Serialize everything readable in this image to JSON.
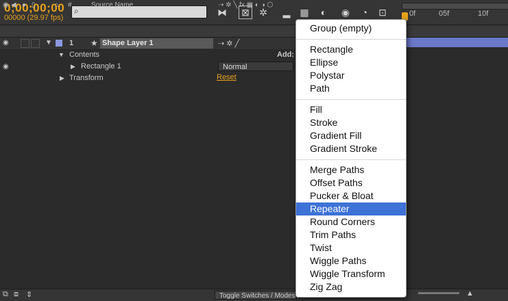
{
  "toolbar": {
    "timecode": "0;00;00;00",
    "frames": "00000 (29.97 fps)",
    "search_placeholder": ""
  },
  "ruler": {
    "ticks": [
      "0f",
      "05f",
      "10f"
    ]
  },
  "columns": {
    "number": "#",
    "source_name": "Source Name"
  },
  "layer": {
    "index": "1",
    "name": "Shape Layer 1"
  },
  "contents": {
    "label": "Contents",
    "add_label": "Add:"
  },
  "rectangle": {
    "label": "Rectangle 1",
    "blend_mode": "Normal"
  },
  "transform": {
    "label": "Transform",
    "reset": "Reset"
  },
  "bottom": {
    "toggle_label": "Toggle Switches / Modes"
  },
  "menu": {
    "items": [
      "Group (empty)",
      "Rectangle",
      "Ellipse",
      "Polystar",
      "Path",
      "Fill",
      "Stroke",
      "Gradient Fill",
      "Gradient Stroke",
      "Merge Paths",
      "Offset Paths",
      "Pucker & Bloat",
      "Repeater",
      "Round Corners",
      "Trim Paths",
      "Twist",
      "Wiggle Paths",
      "Wiggle Transform",
      "Zig Zag"
    ],
    "selected": "Repeater"
  },
  "colors": {
    "accent": "#e8a21c",
    "selection": "#3d72d6",
    "layer_bar": "#6c78c9"
  }
}
